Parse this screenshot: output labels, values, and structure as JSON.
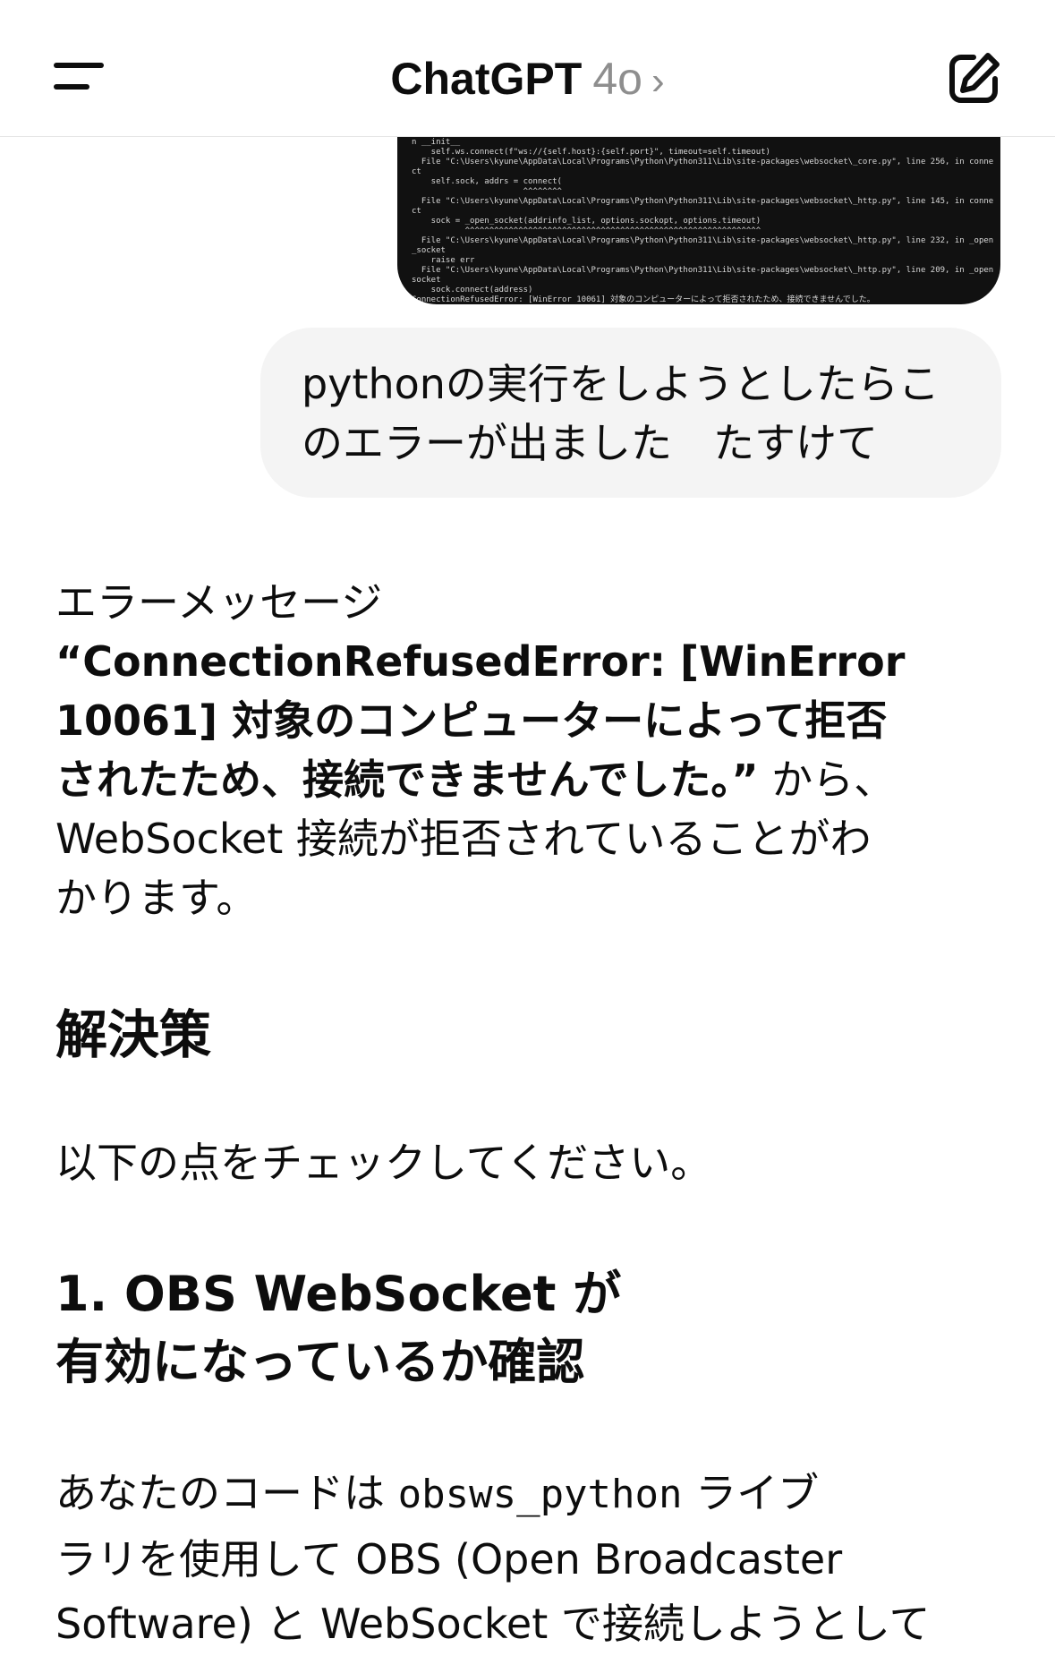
{
  "header": {
    "title": "ChatGPT",
    "model": "4o",
    "chevron": "›"
  },
  "attachment": {
    "terminal_lines": [
      "n __init__",
      "    self.ws.connect(f\"ws://{self.host}:{self.port}\", timeout=self.timeout)",
      "  File \"C:\\Users\\kyune\\AppData\\Local\\Programs\\Python\\Python311\\Lib\\site-packages\\websocket\\_core.py\", line 256, in conne",
      "ct",
      "    self.sock, addrs = connect(",
      "                       ^^^^^^^^",
      "  File \"C:\\Users\\kyune\\AppData\\Local\\Programs\\Python\\Python311\\Lib\\site-packages\\websocket\\_http.py\", line 145, in conne",
      "ct",
      "    sock = _open_socket(addrinfo_list, options.sockopt, options.timeout)",
      "           ^^^^^^^^^^^^^^^^^^^^^^^^^^^^^^^^^^^^^^^^^^^^^^^^^^^^^^^^^^^^^",
      "  File \"C:\\Users\\kyune\\AppData\\Local\\Programs\\Python\\Python311\\Lib\\site-packages\\websocket\\_http.py\", line 232, in _open",
      "_socket",
      "    raise err",
      "  File \"C:\\Users\\kyune\\AppData\\Local\\Programs\\Python\\Python311\\Lib\\site-packages\\websocket\\_http.py\", line 209, in _open",
      "socket",
      "    sock.connect(address)",
      "ConnectionRefusedError: [WinError 10061] 対象のコンピューターによって拒否されたため、接続できませんでした。"
    ]
  },
  "user_message": {
    "line1": "pythonの実行をしようとしたらこ",
    "line2": "のエラーが出ました　たすけて"
  },
  "response": {
    "intro_line1": "エラーメッセージ",
    "error_bold_l1": "“ConnectionRefusedError: [WinError",
    "error_bold_l2": "10061] 対象のコンピューターによって拒否",
    "error_bold_l3": "されたため、接続できませんでした。”",
    "error_tail": " から、",
    "explain_l1": "WebSocket 接続が拒否されていることがわ",
    "explain_l2": "かります。",
    "solution_heading": "解決策",
    "check_text": "以下の点をチェックしてください。",
    "step1_heading_l1": "1. OBS WebSocket が",
    "step1_heading_l2": "有効になっているか確認",
    "body_l1_pre": "あなたのコードは ",
    "body_l1_code": "obsws_python",
    "body_l1_post": " ライブ",
    "body_l2": "ラリを使用して OBS (Open Broadcaster",
    "body_l3": "Software) と WebSocket で接続しようとして"
  }
}
